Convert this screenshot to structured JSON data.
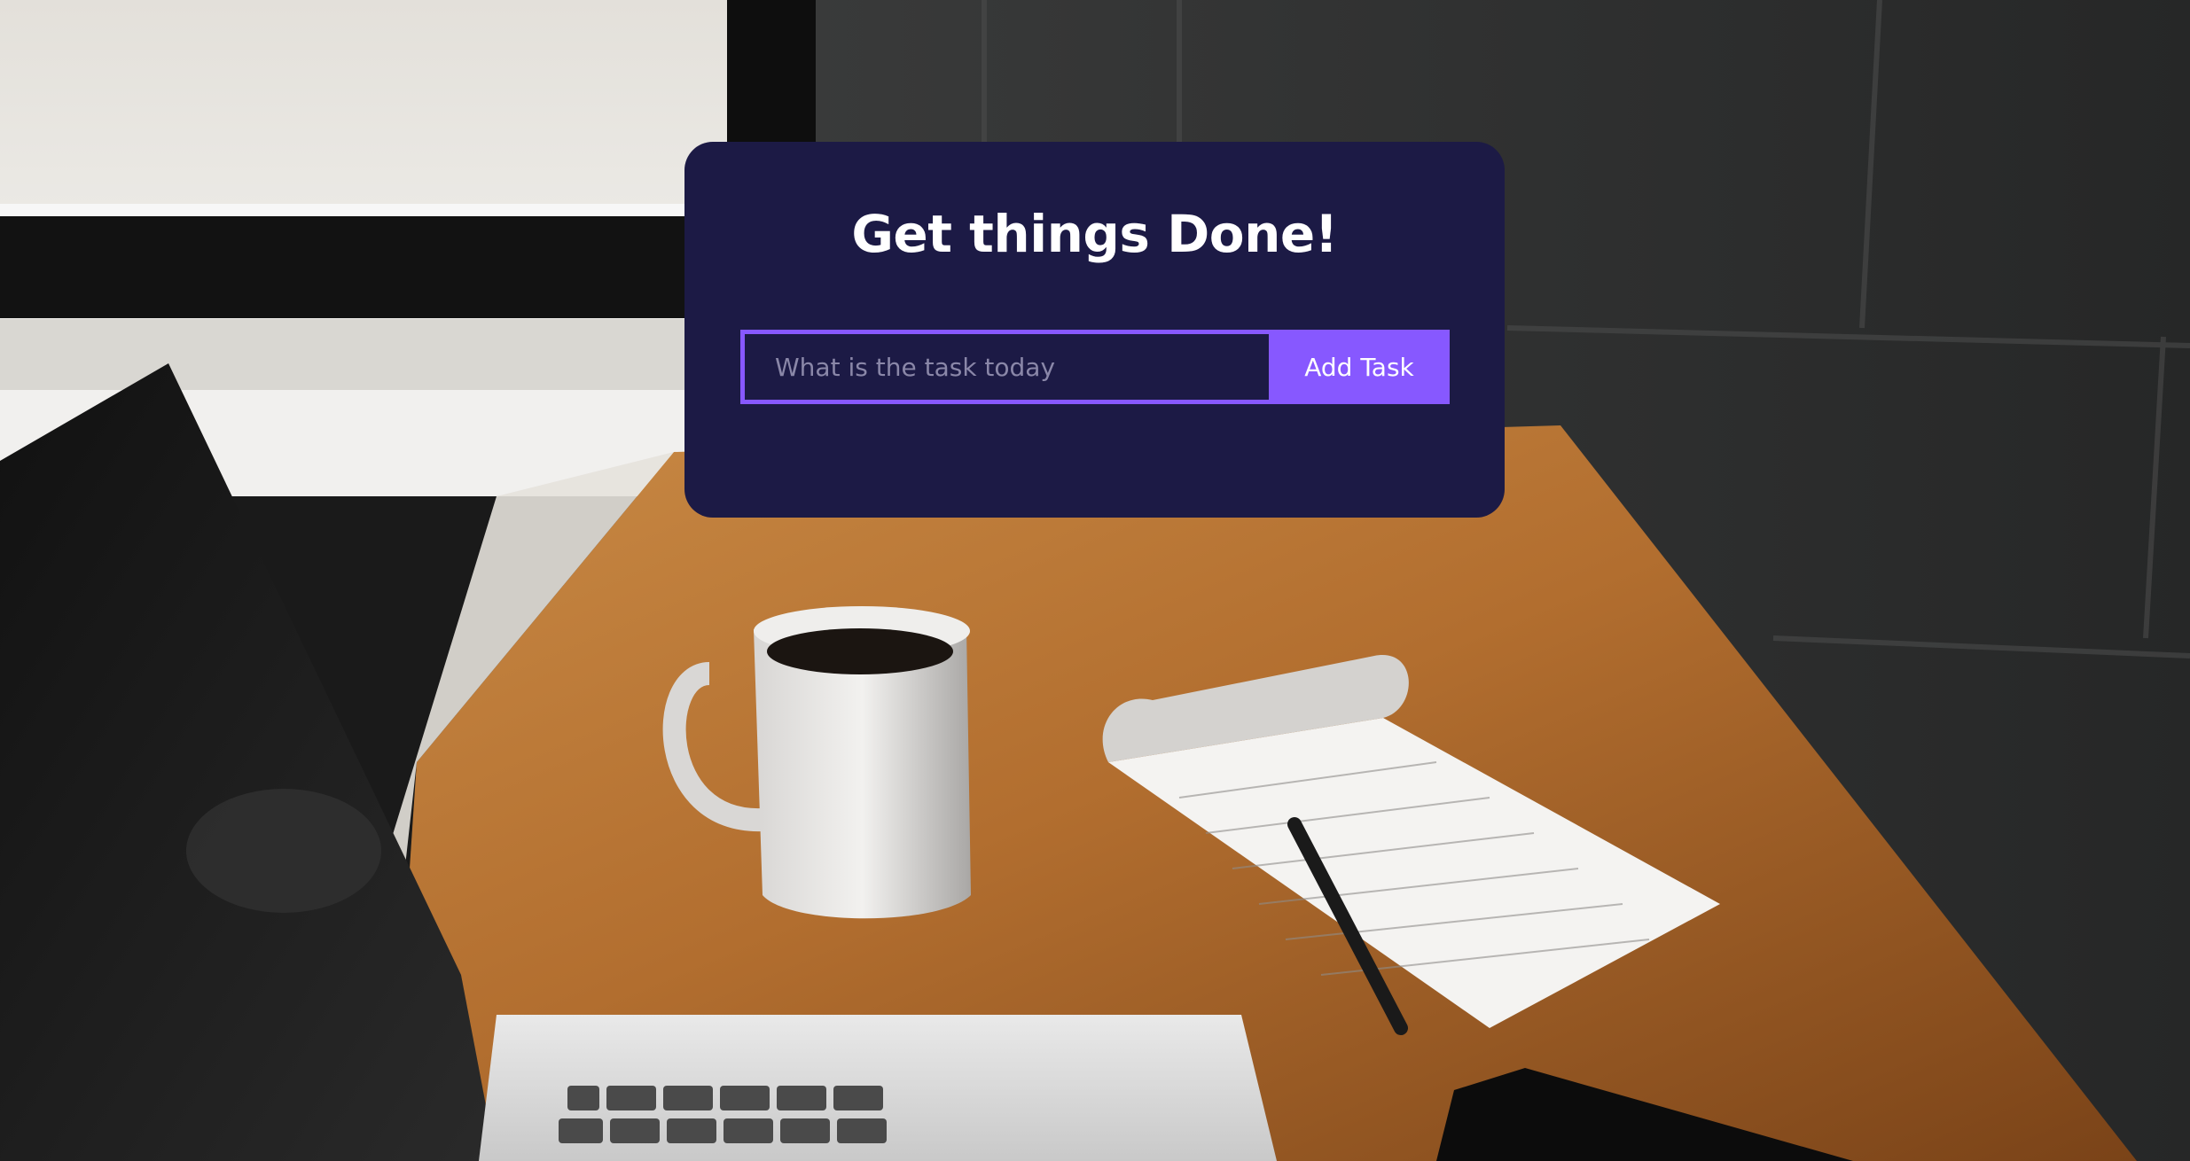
{
  "app": {
    "title": "Get things Done!"
  },
  "task_form": {
    "input_value": "",
    "input_placeholder": "What is the task today",
    "add_button_label": "Add Task"
  },
  "colors": {
    "card_background": "#1c1a45",
    "accent": "#8758ff",
    "title_text": "#ffffff"
  }
}
